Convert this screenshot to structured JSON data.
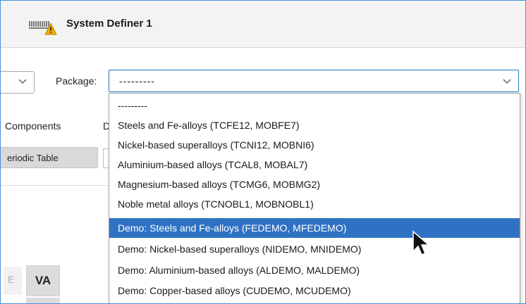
{
  "window": {
    "title": "System Definer 1",
    "icon": "system-definer-warning-icon"
  },
  "toolbar": {
    "package_label": "Package:",
    "package_value": "---------"
  },
  "tabs": {
    "components": "Components",
    "d_partial": "D"
  },
  "buttons": {
    "periodic_table": "eriodic Table"
  },
  "elements": {
    "e_partial": "E",
    "va": "VA"
  },
  "dropdown": {
    "options": [
      "---------",
      "Steels and Fe-alloys (TCFE12, MOBFE7)",
      "Nickel-based superalloys (TCNI12, MOBNI6)",
      "Aluminium-based alloys (TCAL8, MOBAL7)",
      "Magnesium-based alloys (TCMG6, MOBMG2)",
      "Noble metal alloys (TCNOBL1, MOBNOBL1)",
      "Demo: Steels and Fe-alloys (FEDEMO, MFEDEMO)",
      "Demo: Nickel-based superalloys (NIDEMO, MNIDEMO)",
      "Demo: Aluminium-based alloys (ALDEMO, MALDEMO)",
      "Demo: Copper-based alloys (CUDEMO, MCUDEMO)"
    ],
    "selected_index": 6
  },
  "colors": {
    "accent": "#2f72c4",
    "selection_text": "#ffffff",
    "warning": "#f2a900"
  }
}
